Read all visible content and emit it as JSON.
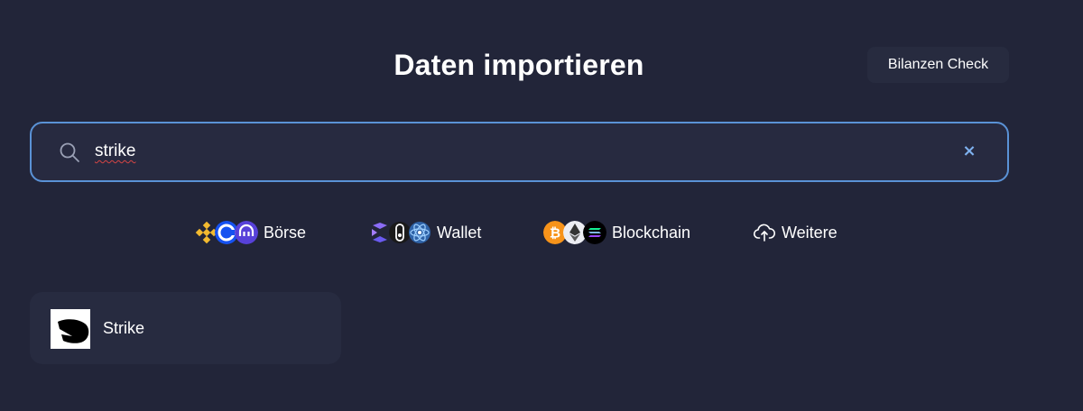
{
  "header": {
    "title": "Daten importieren",
    "bilanzen_check_label": "Bilanzen Check"
  },
  "search": {
    "value": "strike",
    "placeholder": "",
    "search_icon": "search-icon",
    "clear_icon": "close-icon",
    "clear_label": "×"
  },
  "categories": [
    {
      "label": "Börse",
      "icons": [
        "binance-logo",
        "coinbase-logo",
        "kraken-logo"
      ]
    },
    {
      "label": "Wallet",
      "icons": [
        "exodus-logo",
        "ledger-logo",
        "electrum-logo"
      ]
    },
    {
      "label": "Blockchain",
      "icons": [
        "bitcoin-logo",
        "ethereum-logo",
        "solana-logo"
      ]
    },
    {
      "label": "Weitere",
      "icons": [
        "cloud-upload-icon"
      ]
    }
  ],
  "results": [
    {
      "name": "Strike",
      "icon": "strike-logo"
    }
  ],
  "colors": {
    "background": "#222539",
    "search_border": "#5a92d6",
    "accent": "#7fb2f0",
    "card": "#272b40"
  }
}
